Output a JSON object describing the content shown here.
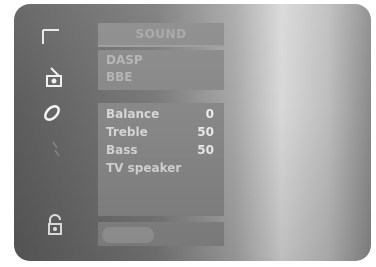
{
  "menu": {
    "title": "SOUND",
    "disabled_items": [
      "DASP",
      "BBE"
    ],
    "items": [
      {
        "label": "Balance",
        "value": "0"
      },
      {
        "label": "Treble",
        "value": "50"
      },
      {
        "label": "Bass",
        "value": "50"
      },
      {
        "label": "TV speaker",
        "value": ""
      }
    ]
  },
  "icons": {
    "picture": "picture-icon",
    "sound": "sound-icon",
    "channel": "channel-icon",
    "setup": "setup-icon",
    "lock": "lock-icon"
  },
  "colors": {
    "panel": "#888888",
    "text": "#d8d8d8",
    "disabled_text": "#b3b3b3"
  }
}
